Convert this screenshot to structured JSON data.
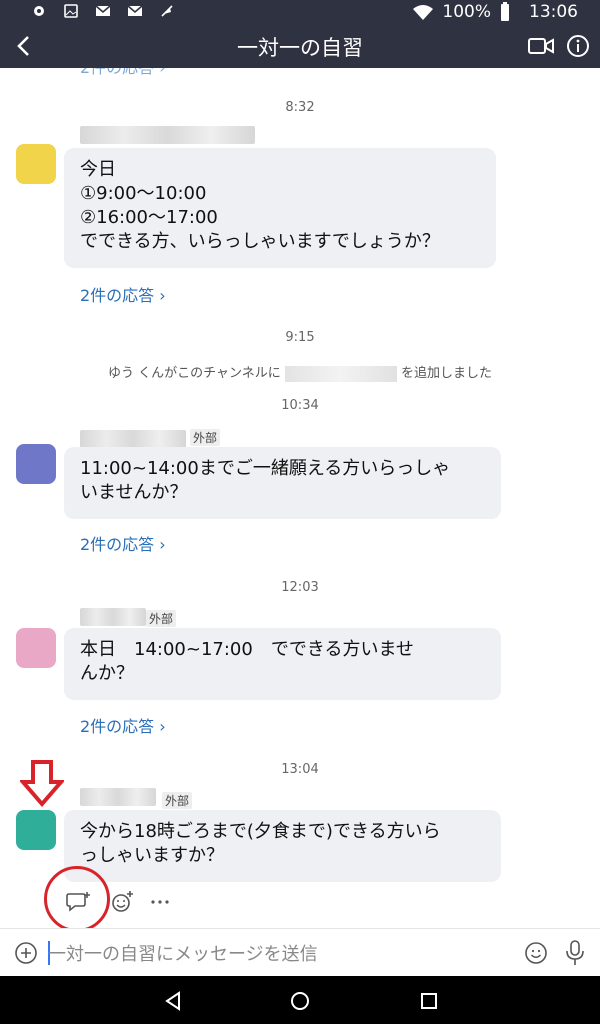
{
  "status_bar": {
    "battery": "100%",
    "clock": "13:06",
    "icons": [
      "settings-icon",
      "image-icon",
      "gmail-icon",
      "gmail-icon",
      "mute-icon",
      "wifi-icon",
      "battery-icon"
    ]
  },
  "header": {
    "title": "一対一の自習"
  },
  "messages": [
    {
      "time": "8:32",
      "lines": [
        "今日",
        "①9:00〜10:00",
        "②16:00〜17:00",
        "でできる方、いらっしゃいますでしょうか？"
      ],
      "replies": "2件の応答 ›",
      "avatar_color": "#f1d44a"
    },
    {
      "time": "10:34",
      "external": "外部",
      "lines": [
        "11:00~14:00までご一緒願える方いらっしゃ",
        "いませんか？"
      ],
      "replies": "2件の応答 ›",
      "avatar_color": "#6f78c8"
    },
    {
      "time": "12:03",
      "external": "外部",
      "lines": [
        "本日　14:00~17:00　でできる方いませ",
        "んか？"
      ],
      "replies": "2件の応答 ›",
      "avatar_color": "#e9a9c6"
    },
    {
      "time": "13:04",
      "external": "外部",
      "lines": [
        "今から18時ごろまで(夕食まで)できる方いら",
        "っしゃいますか？"
      ],
      "avatar_color": "#2fae9a"
    }
  ],
  "system": {
    "time": "9:15",
    "prefix": "ゆう くんがこのチャンネルに",
    "suffix": "を追加しました"
  },
  "composer": {
    "placeholder": "一対一の自習にメッセージを送信"
  },
  "colors": {
    "header_bg": "#2f3240",
    "link": "#2a6fb8",
    "bubble": "#eff0f4",
    "annotation_red": "#d8232a"
  }
}
